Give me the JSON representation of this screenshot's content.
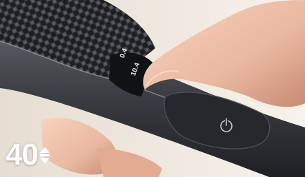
{
  "badge": {
    "length_value": "40",
    "adjust_icon": "up-down-arrows-icon"
  },
  "dial": {
    "label_upper": "0.4",
    "label_lower": "10.4"
  },
  "power_button": {
    "icon": "power-icon"
  },
  "colors": {
    "body_dark": "#2b2d31",
    "grip_pattern": "#1a1b1e",
    "skin": "#e9b8a0",
    "background": "#f1ece6"
  }
}
